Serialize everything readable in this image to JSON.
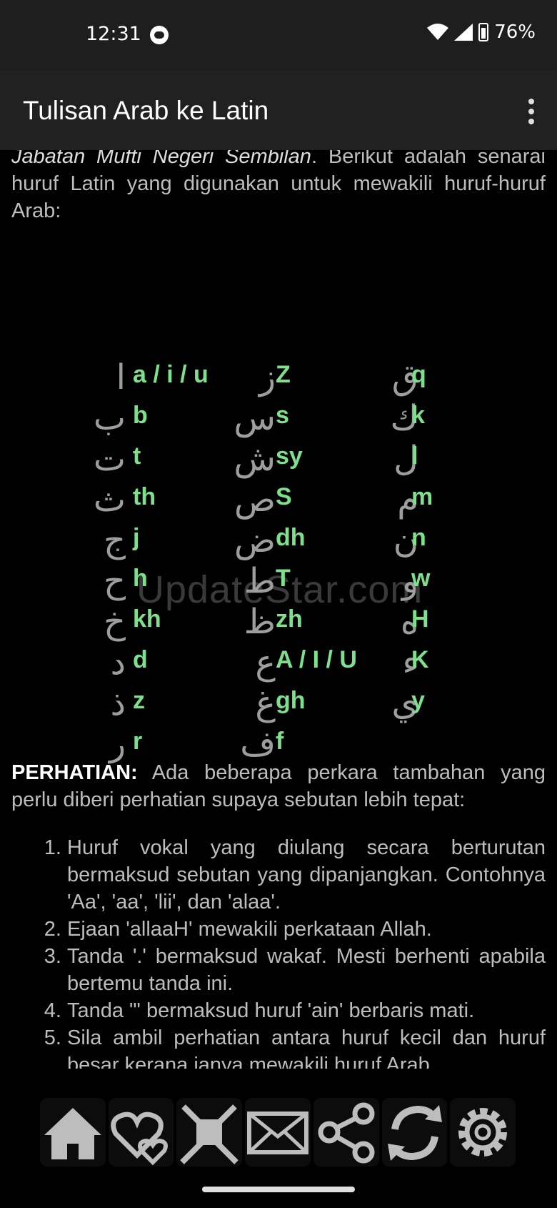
{
  "status": {
    "time": "12:31",
    "battery": "76%"
  },
  "appbar": {
    "title": "Tulisan Arab ke Latin"
  },
  "content": {
    "intro_italic": "Jabatan Mufti Negeri Sembilan",
    "intro_rest": ". Berikut adalah senarai huruf Latin yang digunakan untuk mewakili huruf-huruf Arab:",
    "letters": {
      "col1": [
        {
          "ar": "ا",
          "lat": "a / i / u"
        },
        {
          "ar": "ب",
          "lat": "b"
        },
        {
          "ar": "ت",
          "lat": "t"
        },
        {
          "ar": "ث",
          "lat": "th"
        },
        {
          "ar": "ج",
          "lat": "j"
        },
        {
          "ar": "ح",
          "lat": "h"
        },
        {
          "ar": "خ",
          "lat": "kh"
        },
        {
          "ar": "د",
          "lat": "d"
        },
        {
          "ar": "ذ",
          "lat": "z"
        },
        {
          "ar": "ر",
          "lat": "r"
        }
      ],
      "col2": [
        {
          "ar": "ز",
          "lat": "Z"
        },
        {
          "ar": "س",
          "lat": "s"
        },
        {
          "ar": "ش",
          "lat": "sy"
        },
        {
          "ar": "ص",
          "lat": "S"
        },
        {
          "ar": "ض",
          "lat": "dh"
        },
        {
          "ar": "ط",
          "lat": "T"
        },
        {
          "ar": "ظ",
          "lat": "zh"
        },
        {
          "ar": "ع",
          "lat": "A / I / U"
        },
        {
          "ar": "غ",
          "lat": "gh"
        },
        {
          "ar": "ف",
          "lat": "f"
        }
      ],
      "col3": [
        {
          "ar": "ق",
          "lat": "q"
        },
        {
          "ar": "ك",
          "lat": "k"
        },
        {
          "ar": "ل",
          "lat": "l"
        },
        {
          "ar": "م",
          "lat": "m"
        },
        {
          "ar": "ن",
          "lat": "n"
        },
        {
          "ar": "و",
          "lat": "w"
        },
        {
          "ar": "ه",
          "lat": "H"
        },
        {
          "ar": "ء",
          "lat": "K"
        },
        {
          "ar": "ي",
          "lat": "y"
        }
      ]
    },
    "watermark": "UpdateStar.com",
    "notice_label": "PERHATIAN:",
    "notice_text": " Ada beberapa perkara tambahan yang perlu diberi perhatian supaya sebutan lebih tepat:",
    "notes": [
      "Huruf vokal yang diulang secara berturutan bermaksud sebutan yang dipanjangkan. Contohnya 'Aa', 'aa', 'lii', dan 'alaa'.",
      "Ejaan 'allaaH' mewakili perkataan Allah.",
      "Tanda '.' bermaksud wakaf. Mesti berhenti apabila bertemu tanda ini.",
      "Tanda \"' bermaksud huruf 'ain' berbaris mati.",
      "Sila ambil perhatian antara huruf kecil dan huruf besar kerana ianya mewakili huruf Arab"
    ]
  },
  "nav": {
    "icons": [
      "home-icon",
      "favorites-icon",
      "tools-icon",
      "mail-icon",
      "share-icon",
      "refresh-icon",
      "settings-icon"
    ]
  }
}
